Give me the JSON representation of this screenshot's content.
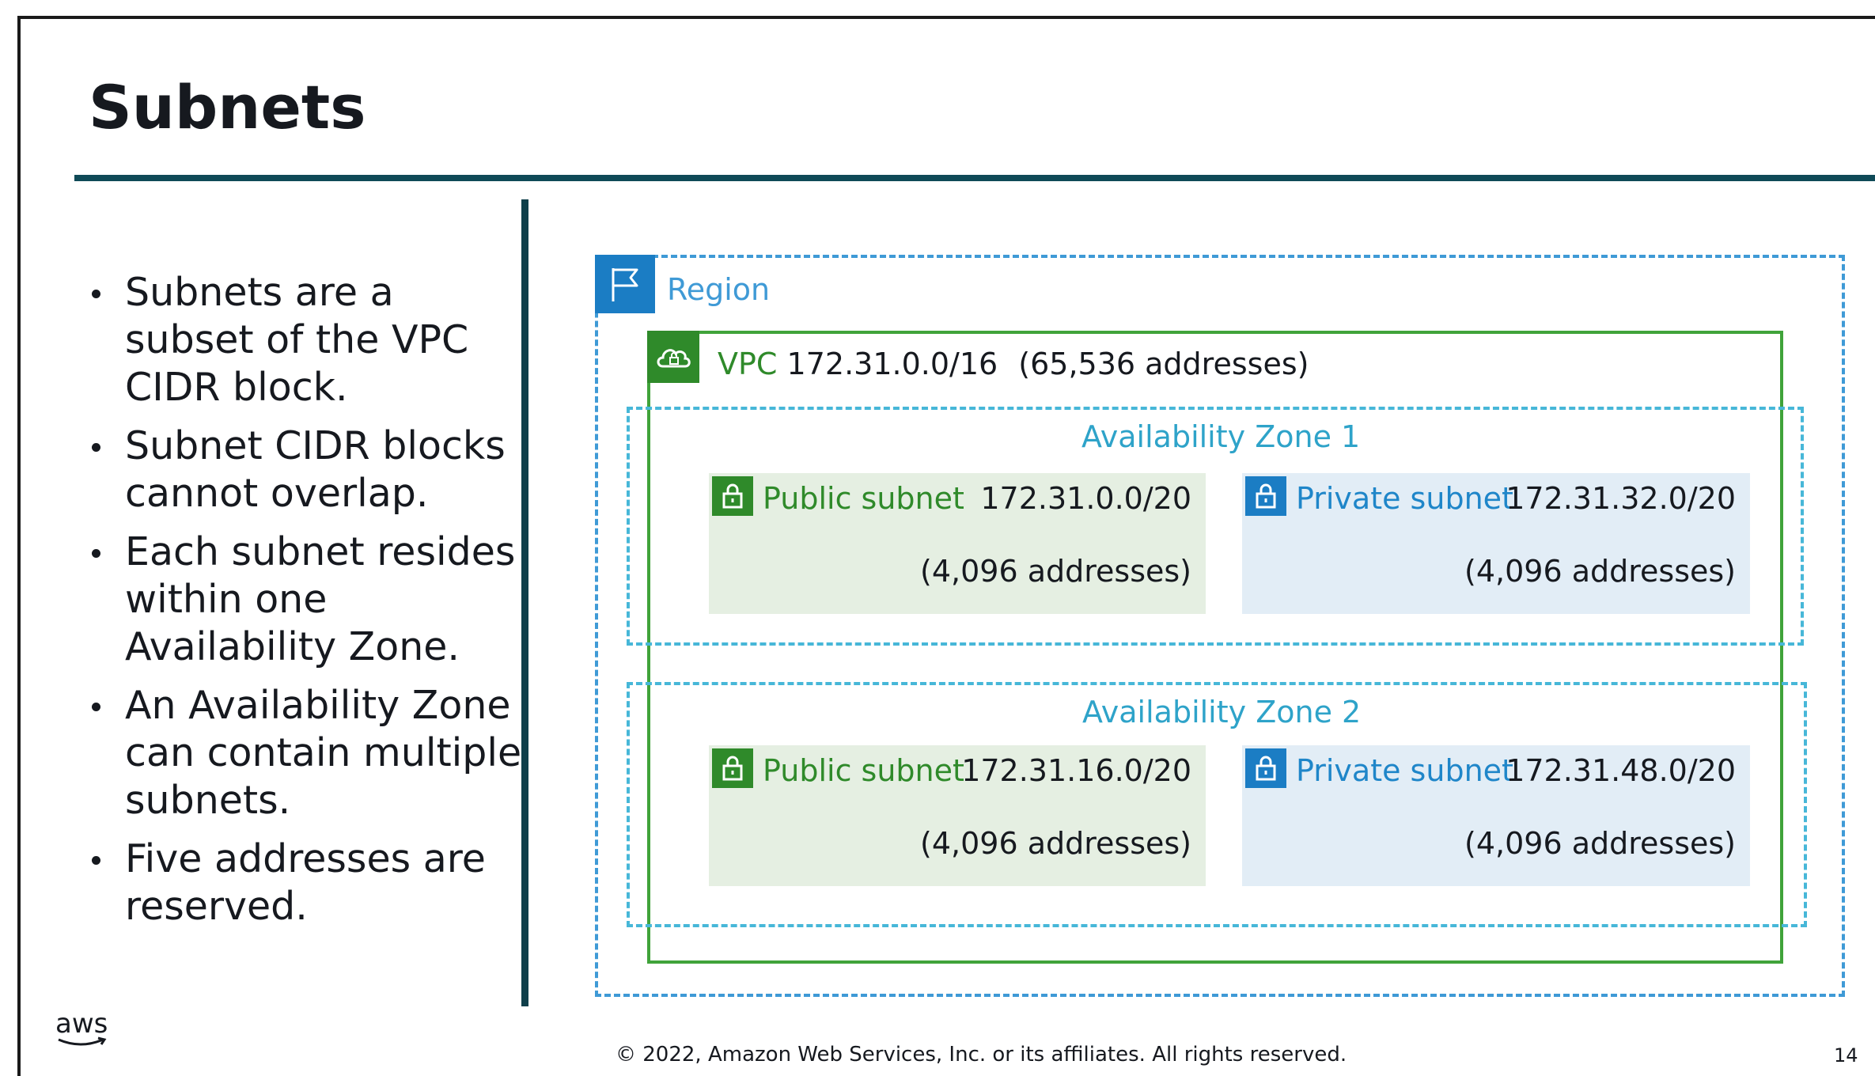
{
  "slide": {
    "title": "Subnets",
    "bullets": [
      "Subnets are a subset of the VPC CIDR block.",
      "Subnet CIDR blocks cannot overlap.",
      "Each subnet resides within one Availability Zone.",
      "An Availability Zone can contain multiple subnets.",
      "Five addresses are reserved."
    ]
  },
  "diagram": {
    "region_label": "Region",
    "vpc": {
      "word": "VPC",
      "cidr": "172.31.0.0/16",
      "addresses": "(65,536 addresses)"
    },
    "zones": [
      {
        "label": "Availability Zone 1",
        "public": {
          "name": "Public subnet",
          "cidr": "172.31.0.0/20",
          "addresses": "(4,096 addresses)"
        },
        "private": {
          "name": "Private subnet",
          "cidr": "172.31.32.0/20",
          "addresses": "(4,096 addresses)"
        }
      },
      {
        "label": "Availability Zone 2",
        "public": {
          "name": "Public subnet",
          "cidr": "172.31.16.0/20",
          "addresses": "(4,096 addresses)"
        },
        "private": {
          "name": "Private subnet",
          "cidr": "172.31.48.0/20",
          "addresses": "(4,096 addresses)"
        }
      }
    ],
    "icons": {
      "region": "flag-icon",
      "vpc": "cloud-lock-icon",
      "subnet": "padlock-icon"
    },
    "colors": {
      "region": "#1b7dc4",
      "vpc": "#2f8a2a",
      "az": "#47b7d8",
      "public_bg": "#e5efe2",
      "private_bg": "#e2edf6"
    }
  },
  "footer": {
    "logo": "aws",
    "copyright": "© 2022, Amazon Web Services, Inc. or its affiliates. All rights reserved.",
    "page_number": "14"
  }
}
